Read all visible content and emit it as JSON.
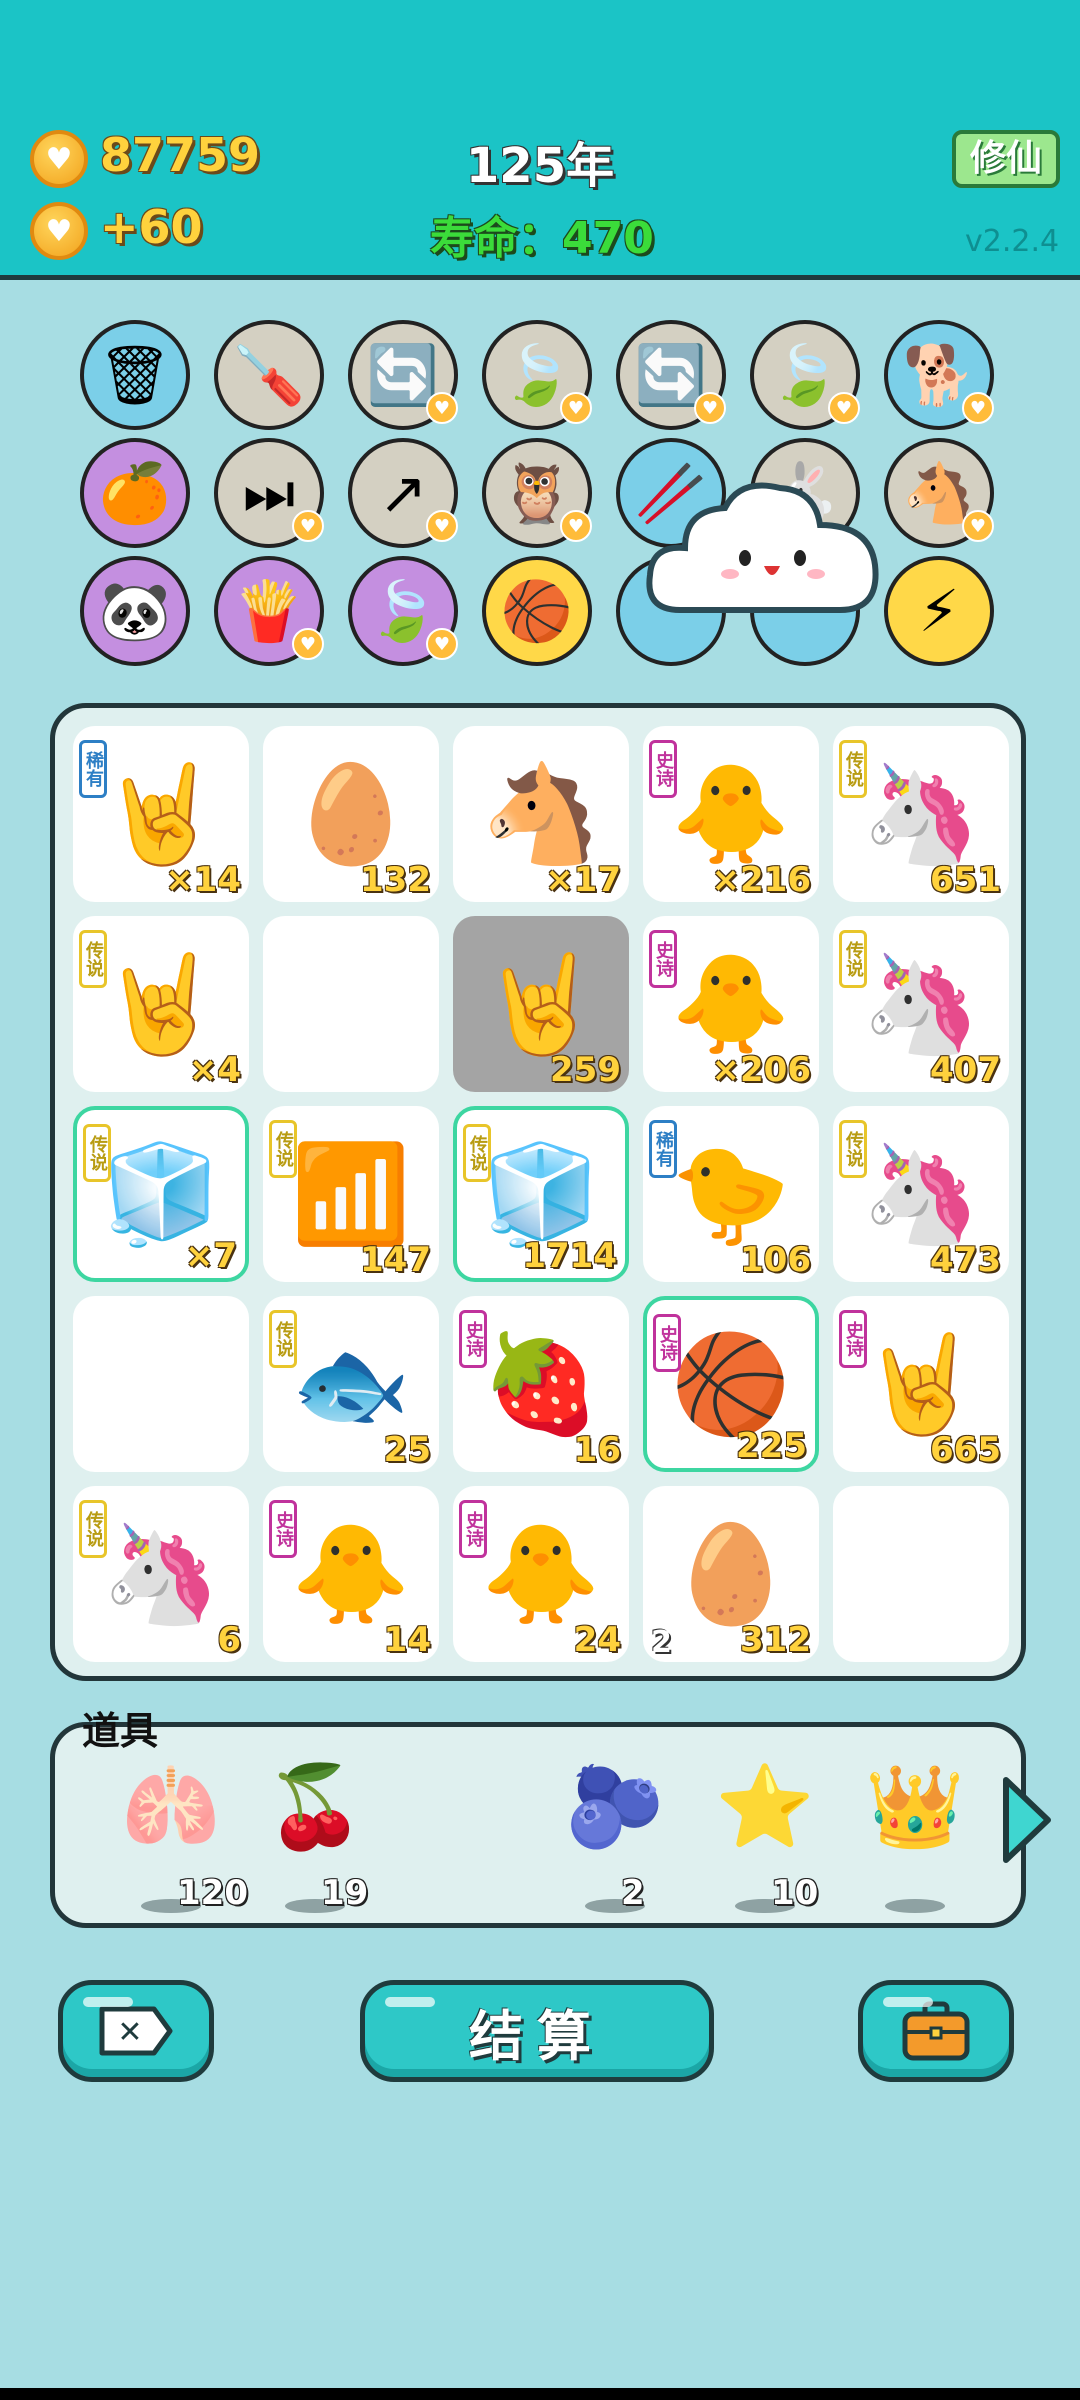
{
  "header": {
    "coins": "87759",
    "income": "+60",
    "year": "125年",
    "lifespan": "寿命：470",
    "xiuxian_label": "修仙",
    "version": "v2.2.4"
  },
  "icons": [
    {
      "emoji": "🗑",
      "heart": false
    },
    {
      "emoji": "🪛",
      "heart": false
    },
    {
      "emoji": "🔄",
      "heart": true
    },
    {
      "emoji": "🍃",
      "heart": true
    },
    {
      "emoji": "🔄",
      "heart": true
    },
    {
      "emoji": "🍃",
      "heart": true
    },
    {
      "emoji": "🐕",
      "heart": true
    },
    {
      "emoji": "🍊",
      "heart": false
    },
    {
      "emoji": "⏭",
      "heart": true
    },
    {
      "emoji": "↗",
      "heart": true
    },
    {
      "emoji": "🦉",
      "heart": true
    },
    {
      "emoji": "🥢",
      "heart": false
    },
    {
      "emoji": "🐇",
      "heart": false
    },
    {
      "emoji": "🐴",
      "heart": true
    },
    {
      "emoji": "🐼",
      "heart": false
    },
    {
      "emoji": "🍟",
      "heart": true
    },
    {
      "emoji": "🍃",
      "heart": true
    },
    {
      "emoji": "🏀",
      "heart": false
    },
    {
      "emoji": "",
      "heart": false
    },
    {
      "emoji": "",
      "heart": false
    },
    {
      "emoji": "⚡",
      "heart": false
    }
  ],
  "board": {
    "cells": [
      {
        "emoji": "🤘",
        "tag": "稀有",
        "tagType": "rare",
        "count": "×14",
        "lvl": ""
      },
      {
        "emoji": "🥚",
        "tag": "",
        "tagType": "",
        "count": "132",
        "lvl": ""
      },
      {
        "emoji": "🐴",
        "tag": "",
        "tagType": "",
        "count": "×17",
        "lvl": ""
      },
      {
        "emoji": "🐥",
        "tag": "史诗",
        "tagType": "epic",
        "count": "×216",
        "lvl": ""
      },
      {
        "emoji": "🦄",
        "tag": "传说",
        "tagType": "legend",
        "count": "651",
        "lvl": ""
      },
      {
        "emoji": "🤘",
        "tag": "传说",
        "tagType": "legend",
        "count": "×4",
        "lvl": ""
      },
      {
        "emoji": "",
        "tag": "",
        "tagType": "",
        "count": "",
        "lvl": ""
      },
      {
        "emoji": "🤘",
        "tag": "",
        "tagType": "",
        "count": "259",
        "lvl": ""
      },
      {
        "emoji": "🐥",
        "tag": "史诗",
        "tagType": "epic",
        "count": "×206",
        "lvl": ""
      },
      {
        "emoji": "🦄",
        "tag": "传说",
        "tagType": "legend",
        "count": "407",
        "lvl": ""
      },
      {
        "emoji": "🧊",
        "tag": "传说",
        "tagType": "legend",
        "count": "×7",
        "lvl": ""
      },
      {
        "emoji": "📶",
        "tag": "传说",
        "tagType": "legend",
        "count": "147",
        "lvl": ""
      },
      {
        "emoji": "🧊",
        "tag": "传说",
        "tagType": "legend",
        "count": "1714",
        "lvl": ""
      },
      {
        "emoji": "🐤",
        "tag": "稀有",
        "tagType": "rare",
        "count": "106",
        "lvl": ""
      },
      {
        "emoji": "🦄",
        "tag": "传说",
        "tagType": "legend",
        "count": "473",
        "lvl": ""
      },
      {
        "emoji": "",
        "tag": "",
        "tagType": "",
        "count": "",
        "lvl": ""
      },
      {
        "emoji": "🐟",
        "tag": "传说",
        "tagType": "legend",
        "count": "25",
        "lvl": ""
      },
      {
        "emoji": "🍓",
        "tag": "史诗",
        "tagType": "epic",
        "count": "16",
        "lvl": ""
      },
      {
        "emoji": "🏀",
        "tag": "史诗",
        "tagType": "epic",
        "count": "225",
        "lvl": ""
      },
      {
        "emoji": "🤘",
        "tag": "史诗",
        "tagType": "epic",
        "count": "665",
        "lvl": ""
      },
      {
        "emoji": "🦄",
        "tag": "传说",
        "tagType": "legend",
        "count": "6",
        "lvl": ""
      },
      {
        "emoji": "🐥",
        "tag": "史诗",
        "tagType": "epic",
        "count": "14",
        "lvl": ""
      },
      {
        "emoji": "🐥",
        "tag": "史诗",
        "tagType": "epic",
        "count": "24",
        "lvl": ""
      },
      {
        "emoji": "🥚",
        "tag": "",
        "tagType": "",
        "count": "312",
        "lvl": "2"
      },
      {
        "emoji": "",
        "tag": "",
        "tagType": "",
        "count": "",
        "lvl": ""
      }
    ]
  },
  "props": {
    "title": "道具",
    "items": [
      {
        "emoji": "🫁",
        "count": "120"
      },
      {
        "emoji": "🍒",
        "count": "19"
      },
      {
        "emoji": "",
        "count": ""
      },
      {
        "emoji": "🫐",
        "count": "2"
      },
      {
        "emoji": "⭐",
        "count": "10"
      },
      {
        "emoji": "👑",
        "count": ""
      }
    ]
  },
  "buttons": {
    "close_icon": "✕",
    "settle_label": "结算",
    "bag_icon": "💼"
  },
  "colors": {
    "header_bg": "#1bc4c6",
    "page_bg": "#a7dde3",
    "gold_text": "#ffd23d",
    "life_text": "#3bdc3a"
  }
}
